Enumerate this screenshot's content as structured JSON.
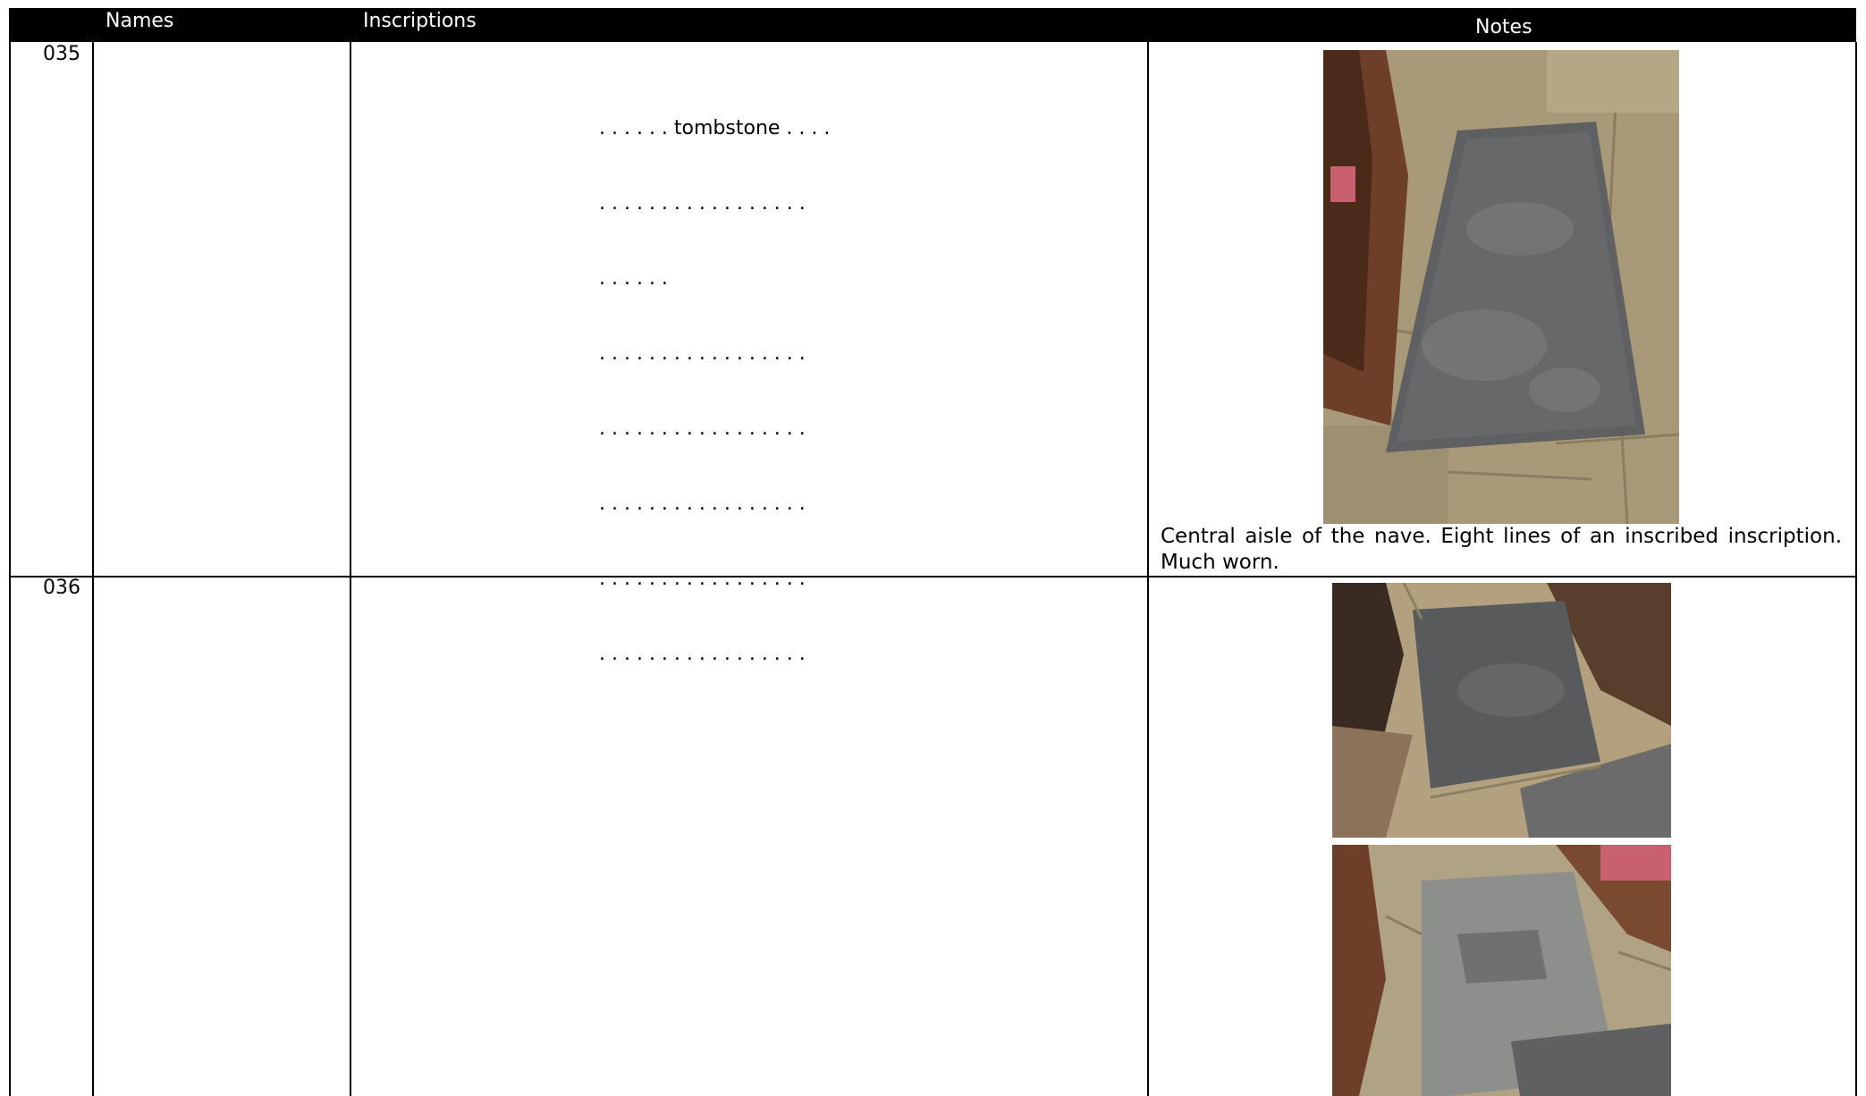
{
  "header": {
    "names_label": "Names",
    "inscriptions_label": "Inscriptions",
    "notes_label": "Notes"
  },
  "rows": [
    {
      "number": "035",
      "names": "",
      "inscription_lines": [
        ". . . . . . tombstone . . . .",
        ". . . . . . . . . . . . . . . . .",
        ". . . . . .",
        ". . . . . . . . . . . . . . . . .",
        ". . . . . . . . . . . . . . . . .",
        ". . . . . . . . . . . . . . . . .",
        ". . . . . . . . . . . . . . . . .",
        ". . . . . . . . . . . . . . . . ."
      ],
      "note": "Central aisle of the nave. Eight lines of an inscribed inscription. Much worn.",
      "photos": [
        "tombstone-photo"
      ]
    },
    {
      "number": "036",
      "names": "",
      "inscription_lines": [],
      "note": "",
      "photos": [
        "slab-photo-upper",
        "slab-photo-lower"
      ]
    }
  ],
  "colors": {
    "header_bg": "#000000",
    "header_text": "#ffffff",
    "slate": "#5e6061",
    "flagstone": "#a89a78",
    "pew_wood": "#7a4a30"
  }
}
